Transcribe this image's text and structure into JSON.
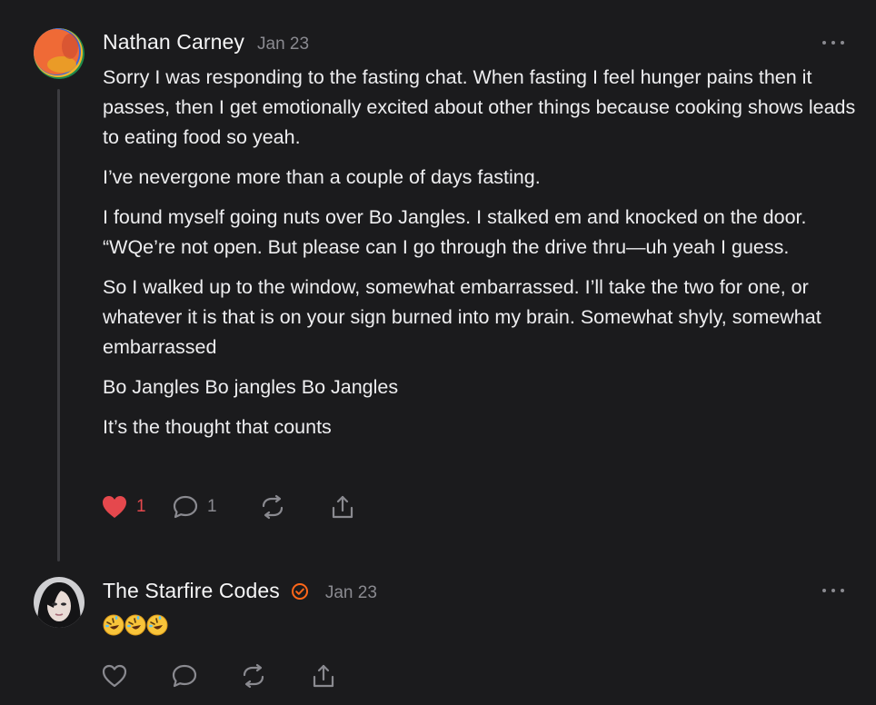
{
  "comments": [
    {
      "author": "Nathan Carney",
      "date": "Jan 23",
      "paragraphs": [
        "Sorry I was responding to the fasting chat. When fasting I feel hunger pains then it passes, then I get emotionally excited about other things because cooking shows leads to eating food so yeah.",
        "I’ve nevergone more than a couple of days fasting.",
        "I found myself going nuts over Bo Jangles. I stalked em and knocked on the door. “WQe’re not open. But please can I go through the drive thru—uh yeah I guess.",
        "So I walked up to the window, somewhat embarrassed. I’ll take the two for one, or whatever it is that is on your sign burned into my brain. Somewhat shyly, somewhat embarrassed",
        "Bo Jangles Bo jangles Bo Jangles",
        "It’s the thought that counts"
      ],
      "likes": "1",
      "liked": true,
      "replies": "1",
      "icons": {
        "like": "heart-icon",
        "reply": "comment-bubble-icon",
        "restack": "restack-icon",
        "share": "share-icon",
        "more": "more-dots-icon"
      }
    },
    {
      "author": "The Starfire Codes",
      "date": "Jan 23",
      "verified": true,
      "emojis": [
        "rofl-emoji",
        "rofl-emoji",
        "rofl-emoji"
      ],
      "likes": "",
      "replies": "",
      "liked": false
    }
  ],
  "colors": {
    "background": "#1b1b1d",
    "text": "#eeeef0",
    "muted": "#8a8a90",
    "liked": "#e5484d",
    "verified": "#ff6719",
    "thread_line": "#3c3c40"
  }
}
